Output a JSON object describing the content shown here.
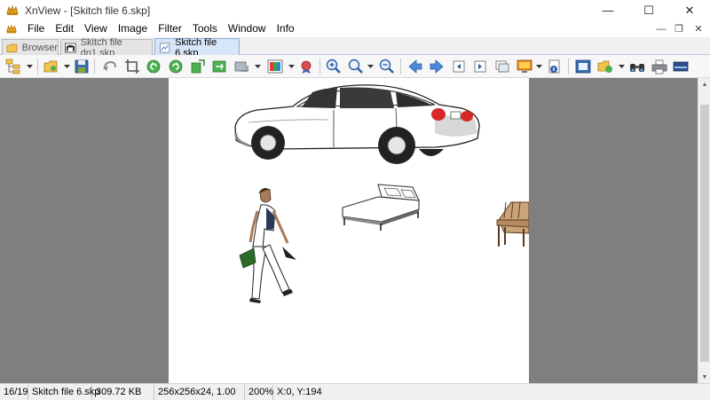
{
  "window": {
    "title": "XnView - [Skitch file 6.skp]",
    "controls": {
      "minimize": "—",
      "maximize": "☐",
      "close": "✕"
    }
  },
  "menu": {
    "items": [
      "File",
      "Edit",
      "View",
      "Image",
      "Filter",
      "Tools",
      "Window",
      "Info"
    ],
    "mdi_controls": {
      "minimize": "—",
      "restore": "❐",
      "close": "✕"
    }
  },
  "tabs": [
    {
      "label": "Browser",
      "icon": "browser-icon",
      "active": false
    },
    {
      "label": "Skitch file dn1.skp",
      "icon": "image-thumbnail-icon",
      "active": false
    },
    {
      "label": "Skitch file 6.skp",
      "icon": "image-file-icon",
      "active": true
    }
  ],
  "toolbar": {
    "icons": [
      "folder-tree-icon",
      "open-folder-icon",
      "save-icon",
      "undo-icon",
      "crop-icon",
      "rotate-left-icon",
      "rotate-right-icon",
      "flip-icon",
      "mirror-icon",
      "resize-icon",
      "adjust-colors-icon",
      "filter-icon",
      "zoom-in-icon",
      "zoom-icon",
      "zoom-out-icon",
      "previous-icon",
      "next-icon",
      "first-page-icon",
      "last-page-icon",
      "slideshow-icon",
      "fullscreen-icon",
      "properties-icon",
      "fit-window-icon",
      "copy-to-icon",
      "find-icon",
      "print-icon",
      "scanner-icon"
    ]
  },
  "colors": {
    "viewer_background": "#7f7f7f",
    "canvas": "#ffffff",
    "active_tab": "#d6e6f8"
  },
  "status": {
    "position": "16/19",
    "filename": "Skitch file 6.skp",
    "filesize": "309.72 KB",
    "dimensions": "256x256x24, 1.00",
    "zoom": "200%",
    "cursor": "X:0, Y:194"
  }
}
